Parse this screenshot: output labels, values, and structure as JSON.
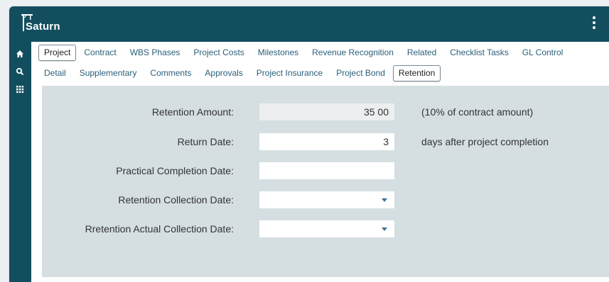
{
  "app": {
    "name": "Saturn",
    "colors": {
      "header": "#124e5e",
      "panel": "#d5dfe2",
      "tab_text": "#2a5f7a",
      "caret": "#3a6f96"
    },
    "menu_icon": "kebab-menu-icon"
  },
  "sidebar": {
    "items": [
      {
        "icon": "home-icon"
      },
      {
        "icon": "search-icon"
      },
      {
        "icon": "grid-icon"
      }
    ]
  },
  "tabs_row1": [
    {
      "label": "Project",
      "active": true
    },
    {
      "label": "Contract"
    },
    {
      "label": "WBS Phases"
    },
    {
      "label": "Project Costs"
    },
    {
      "label": "Milestones"
    },
    {
      "label": "Revenue Recognition"
    },
    {
      "label": "Related"
    },
    {
      "label": "Checklist Tasks"
    },
    {
      "label": "GL Control"
    }
  ],
  "tabs_row2": [
    {
      "label": "Detail"
    },
    {
      "label": "Supplementary"
    },
    {
      "label": "Comments"
    },
    {
      "label": "Approvals"
    },
    {
      "label": "Project Insurance"
    },
    {
      "label": "Project Bond"
    },
    {
      "label": "Retention",
      "active": true
    }
  ],
  "form": {
    "retention_amount": {
      "label": "Retention Amount:",
      "value": "35 00",
      "note": "(10% of contract  amount)"
    },
    "return_date": {
      "label": "Return Date:",
      "value": "3",
      "note": "days after project completion"
    },
    "practical_completion_date": {
      "label": "Practical Completion Date:",
      "value": ""
    },
    "retention_collection_date": {
      "label": "Retention Collection Date:",
      "value": ""
    },
    "actual_collection_date": {
      "label": "Rretention Actual Collection Date:",
      "value": ""
    }
  }
}
